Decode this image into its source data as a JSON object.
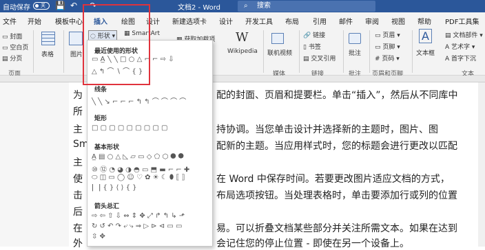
{
  "titlebar": {
    "autosave": "自动保存",
    "toggle": "关",
    "doc": "文档2 - Word",
    "search": "搜索",
    "undo": "↶",
    "redo": "↷",
    "save": "💾"
  },
  "tabs": [
    "文件",
    "开始",
    "模板中心",
    "插入",
    "绘图",
    "设计",
    "新建选项卡",
    "设计",
    "开发工具",
    "布局",
    "引用",
    "邮件",
    "审阅",
    "视图",
    "帮助",
    "PDF工具集"
  ],
  "ribbon": {
    "page_items": [
      "封面",
      "空白页",
      "分页"
    ],
    "page_group": "页面",
    "table": "表格",
    "picture": "图片",
    "shapes": "形状",
    "smartart": "SmartArt",
    "get_addins": "获取加载项",
    "wikipedia": "Wikipedia",
    "wiki_icon": "W",
    "online_video": "联机视频",
    "media_group": "媒体",
    "link_items": [
      "链接",
      "书签",
      "交叉引用"
    ],
    "link_group": "链接",
    "comment": "批注",
    "comment_group": "批注",
    "header_items": [
      "页眉",
      "页脚",
      "页码"
    ],
    "header_group": "页眉和页脚",
    "textbox": "文本框",
    "textbox_icon": "A",
    "text_items": [
      "文档部件",
      "艺术字",
      "首字下沉"
    ],
    "text_group": "文本"
  },
  "panel": {
    "recent": "最近使用的形状",
    "recent_row1": "▭ A̲ ╲ ╲ □ ○ △ ⌐ ⌐ ⇨ ⇩",
    "recent_row2": "△ ↰ ⌒ ∖ ⌒ { }",
    "lines": "线条",
    "lines_row": "╲ ╲ ↘ ⌐ ⌐ ⌐ ↰ ↰ ⌒ ⌒ ⌒ ⌒",
    "rect": "矩形",
    "rect_row": "□ ▢ ▢ ▢ ▢ ▢ ▢ ▢ ▢",
    "basic": "基本形状",
    "basic_rows": [
      "A̲ ▤ ○ △ ◺ ▱ ▭ ◇ ⬠ ⬡ ⯃ ⯄",
      "⑩ ⑫ ◔ ◕ ◑ ◓ ▭ ⬒ ▬ ⌐ ⌐ ✚",
      "⬭ ◫ ▭ ◯ ☺ ♡ ✿ ☀ ☾ ⬮ ⟦ ⟧",
      "⎡ ⎤ { } ⟨ ⟩ { }"
    ],
    "arrows": "箭头总汇",
    "arrow_rows": [
      "⇨ ⇦ ⇧ ⇩ ⇔ ⇕ ✥ ⤢ ↱ ↰ ↳ ⬏",
      "↻ ↺ ↶ ↷ ⤶ ⤷ ⇒ ▷ ⊳ ⊲ ▭ ▭",
      "⇳ ✥"
    ]
  },
  "document": {
    "lines": [
      "为",
      "配的封面、页眉和提要栏。单击“插入”，然后从不同库中",
      "所",
      "主",
      "持协调。当您单击设计并选择新的主题时，图片、图",
      "Sm",
      "配新的主题。当应用样式时，您的标题会进行更改以匹配",
      "主",
      "使",
      "在 Word 中保存时间。若要更改图片适应文档的方式，",
      "击",
      "布局选项按钮。当处理表格时，单击要添加行或列的位置",
      "后",
      "在",
      "易。可以折叠文档某些部分并关注所需文本。如果在达到",
      "外",
      "会记住您的停止位置 - 即使在另一个设备上。"
    ]
  },
  "colors": {
    "accent": "#2b579a",
    "highlight": "#e0323c"
  }
}
